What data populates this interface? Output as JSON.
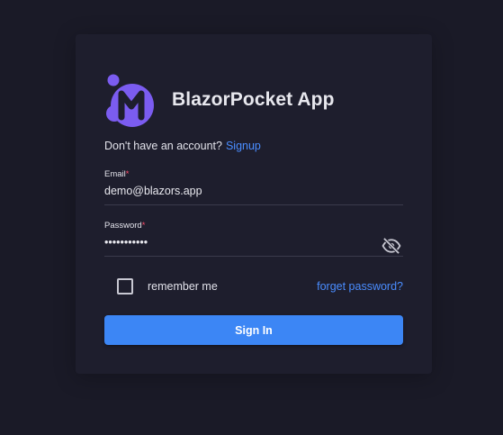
{
  "app": {
    "title": "BlazorPocket App",
    "logo_icon": "m-logo-icon"
  },
  "signup": {
    "prompt": "Don't have an account?",
    "link_label": "Signup"
  },
  "email": {
    "label": "Email",
    "required_mark": "*",
    "value": "demo@blazors.app"
  },
  "password": {
    "label": "Password",
    "required_mark": "*",
    "value": "•••••••••••",
    "toggle_icon": "eye-off-icon"
  },
  "remember": {
    "label": "remember me",
    "checked": false
  },
  "forgot_label": "forget password?",
  "signin_label": "Sign In",
  "colors": {
    "background": "#1a1a27",
    "card": "#1e1e2d",
    "accent": "#3c86f5",
    "link": "#4a8dff",
    "logo": "#7b5cf0"
  }
}
